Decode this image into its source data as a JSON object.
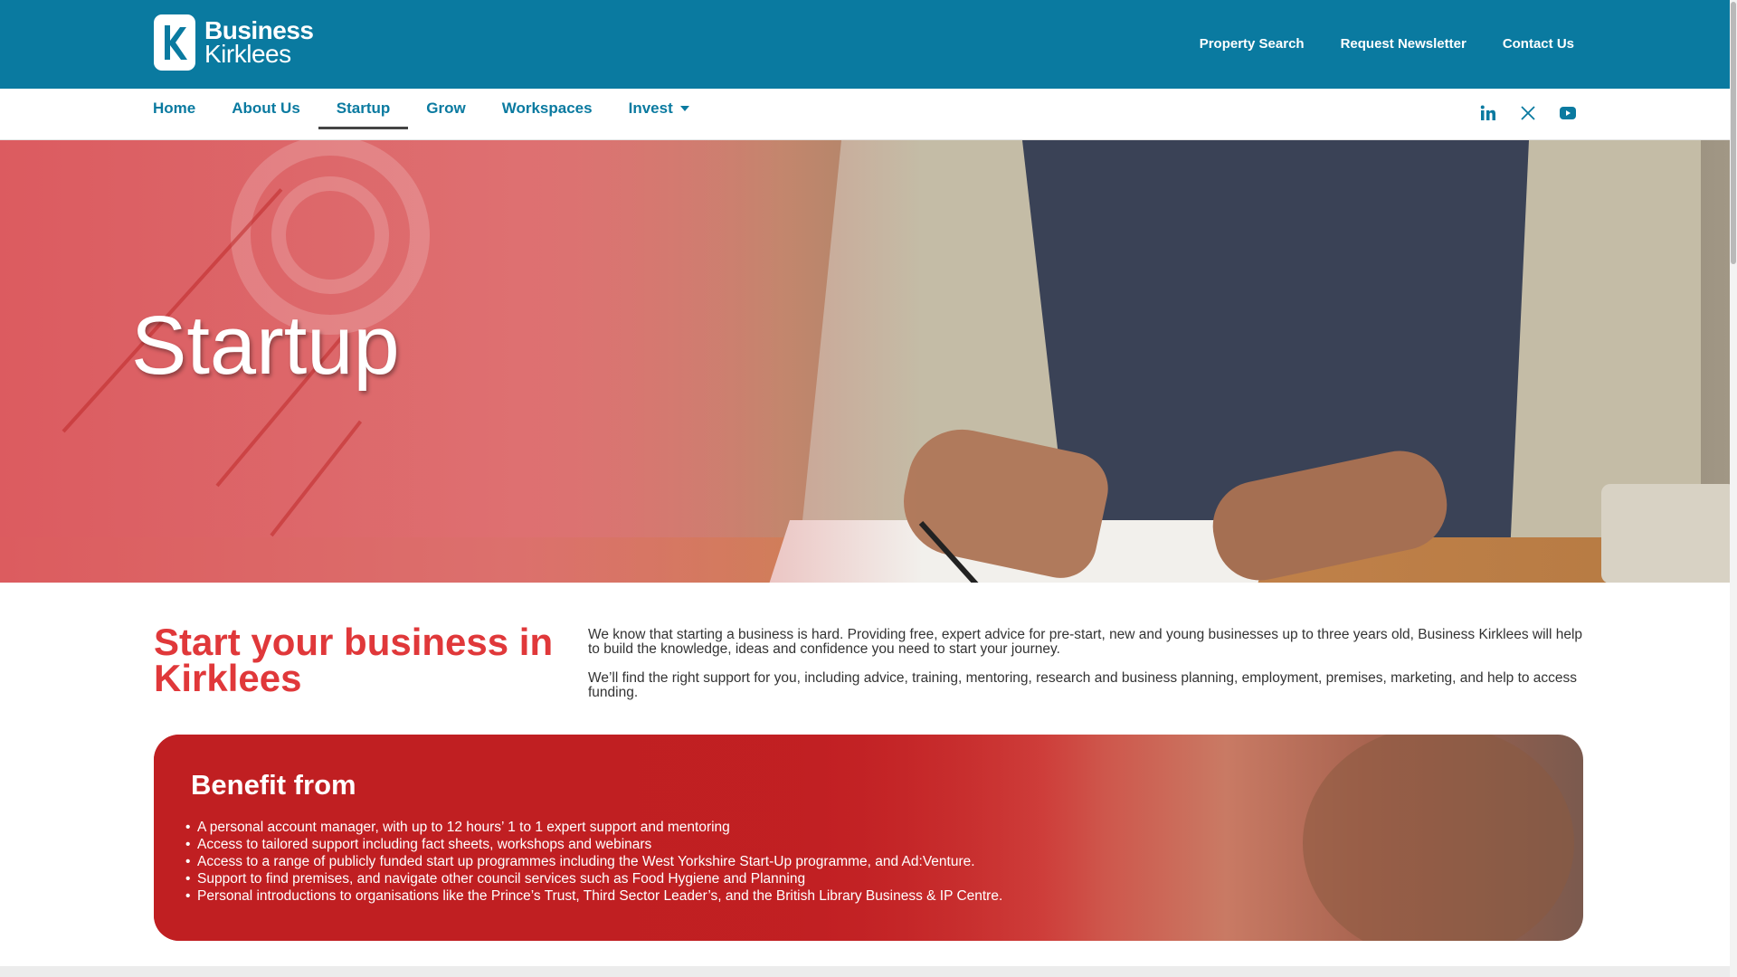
{
  "brand": {
    "line1": "Business",
    "line2": "Kirklees"
  },
  "top_links": [
    "Property Search",
    "Request Newsletter",
    "Contact Us"
  ],
  "nav": {
    "items": [
      {
        "label": "Home"
      },
      {
        "label": "About Us"
      },
      {
        "label": "Startup",
        "active": true
      },
      {
        "label": "Grow"
      },
      {
        "label": "Workspaces"
      },
      {
        "label": "Invest",
        "dropdown": true
      }
    ],
    "socials": [
      "linkedin-icon",
      "x-icon",
      "youtube-icon"
    ]
  },
  "hero": {
    "title": "Startup"
  },
  "intro": {
    "heading": "Start your business in Kirklees",
    "paragraphs": [
      "We know that starting a business is hard. Providing free, expert advice for pre-start, new and young businesses up to three years old, Business Kirklees will help to build the knowledge, ideas and confidence you need to start your journey.",
      "We’ll find the right support for you, including advice, training, mentoring, research and business planning, employment, premises, marketing, and help to access funding."
    ]
  },
  "benefit": {
    "title": "Benefit from",
    "items": [
      "A personal account manager, with up to 12 hours’ 1 to 1 expert support and mentoring",
      "Access to tailored support including fact sheets, workshops and webinars",
      "Access to a range of publicly funded start up programmes including the West Yorkshire Start-Up programme, and Ad:Venture.",
      "Support to find premises, and navigate other council services such as Food Hygiene and Planning",
      "Personal introductions to organisations like the Prince’s Trust, Third Sector Leader’s, and the British Library Business & IP Centre."
    ]
  },
  "colors": {
    "brand_teal": "#0a7aa0",
    "accent_red": "#e0383a",
    "card_red": "#c01f22"
  }
}
